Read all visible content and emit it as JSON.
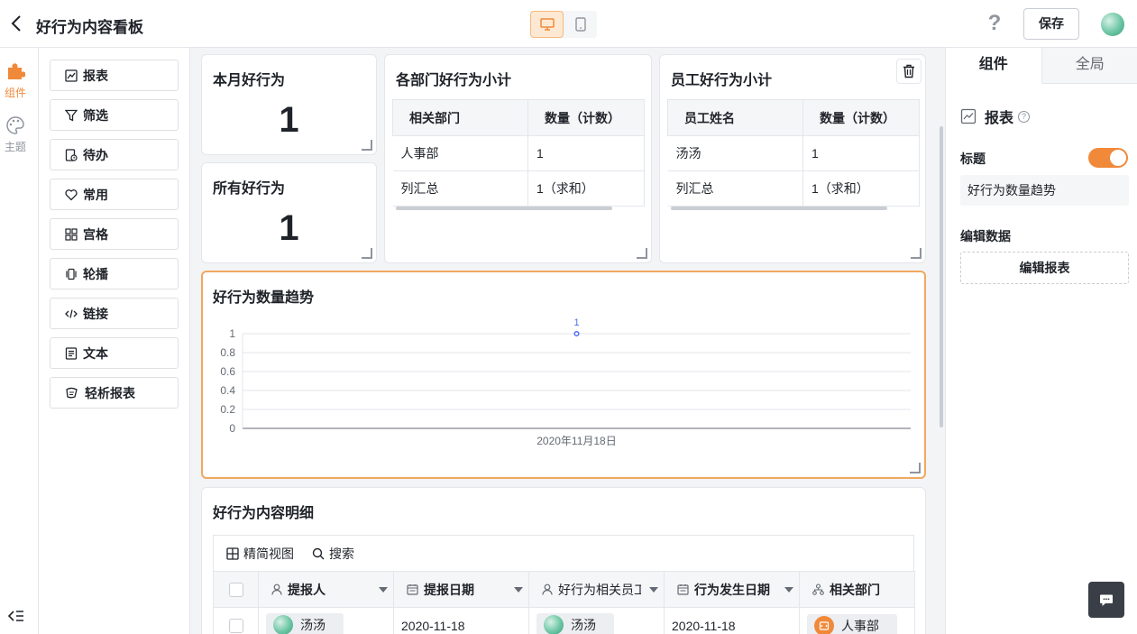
{
  "header": {
    "title": "好行为内容看板",
    "save_label": "保存",
    "help_glyph": "?"
  },
  "rail": {
    "items": [
      {
        "label": "组件",
        "icon": "puzzle-icon",
        "active": true
      },
      {
        "label": "主题",
        "icon": "palette-icon",
        "active": false
      }
    ]
  },
  "palette": {
    "items": [
      {
        "label": "报表",
        "icon": "chart-icon"
      },
      {
        "label": "筛选",
        "icon": "filter-icon"
      },
      {
        "label": "待办",
        "icon": "todo-icon"
      },
      {
        "label": "常用",
        "icon": "heart-icon"
      },
      {
        "label": "宫格",
        "icon": "grid-icon"
      },
      {
        "label": "轮播",
        "icon": "carousel-icon"
      },
      {
        "label": "链接",
        "icon": "code-icon"
      },
      {
        "label": "文本",
        "icon": "text-icon"
      },
      {
        "label": "轻析报表",
        "icon": "analysis-icon"
      }
    ]
  },
  "cards": {
    "month_good": {
      "title": "本月好行为",
      "value": "1"
    },
    "all_good": {
      "title": "所有好行为",
      "value": "1"
    },
    "dept": {
      "title": "各部门好行为小计",
      "headers": [
        "相关部门",
        "数量（计数）"
      ],
      "rows": [
        [
          "人事部",
          "1"
        ],
        [
          "列汇总",
          "1（求和）"
        ]
      ]
    },
    "staff": {
      "title": "员工好行为小计",
      "headers": [
        "员工姓名",
        "数量（计数）"
      ],
      "rows": [
        [
          "汤汤",
          "1"
        ],
        [
          "列汇总",
          "1（求和）"
        ]
      ]
    },
    "trend": {
      "title": "好行为数量趋势"
    },
    "detail": {
      "title": "好行为内容明细",
      "toolbar": {
        "view_label": "精简视图",
        "search_label": "搜索"
      },
      "columns": [
        {
          "label": "提报人",
          "icon": "person-icon"
        },
        {
          "label": "提报日期",
          "icon": "calendar-icon"
        },
        {
          "label": "好行为相关员工",
          "icon": "person-icon"
        },
        {
          "label": "行为发生日期",
          "icon": "calendar-icon"
        },
        {
          "label": "相关部门",
          "icon": "org-icon"
        }
      ],
      "row": {
        "reporter": "汤汤",
        "report_date": "2020-11-18",
        "employee": "汤汤",
        "occur_date": "2020-11-18",
        "dept": "人事部"
      }
    }
  },
  "chart_data": {
    "type": "line",
    "title": "好行为数量趋势",
    "categories": [
      "2020年11月18日"
    ],
    "series": [
      {
        "values": [
          1
        ]
      }
    ],
    "data_labels": [
      "1"
    ],
    "yticks": [
      "0",
      "0.2",
      "0.4",
      "0.6",
      "0.8",
      "1"
    ],
    "ylim": [
      0,
      1
    ],
    "grid": true,
    "color": "#4e6ef2"
  },
  "props": {
    "tabs": [
      "组件",
      "全局"
    ],
    "component_type": "报表",
    "title_label": "标题",
    "title_value": "好行为数量趋势",
    "title_enabled": true,
    "edit_section": "编辑数据",
    "edit_button": "编辑报表"
  },
  "colors": {
    "accent": "#f0893a",
    "selected_border": "#f0a860"
  }
}
